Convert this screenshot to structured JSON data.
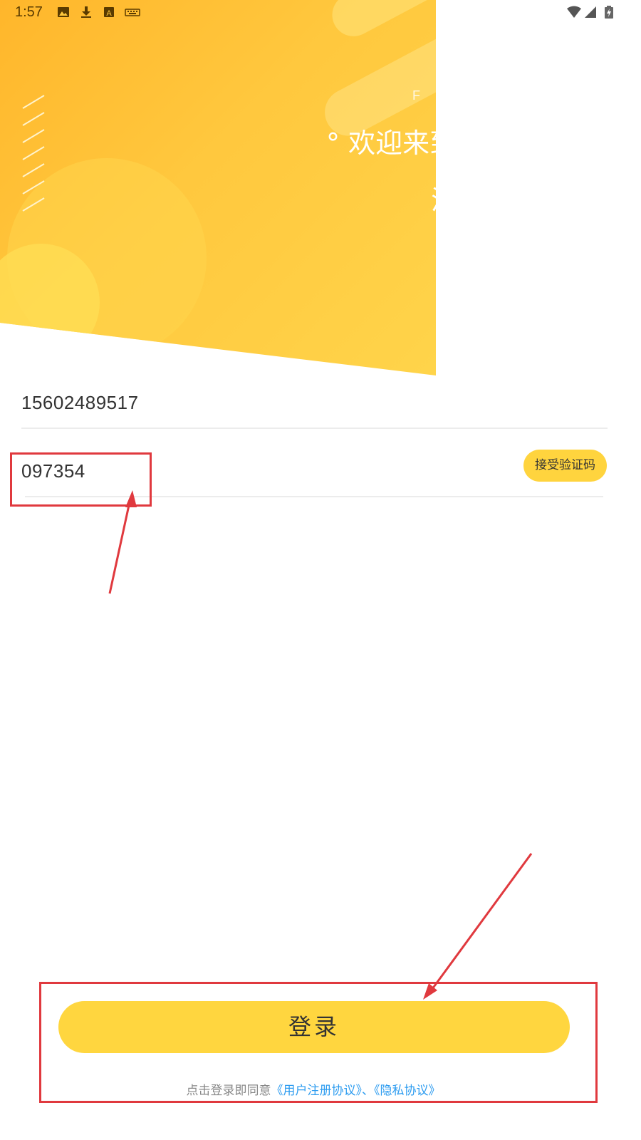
{
  "status_bar": {
    "time": "1:57",
    "left_icons": [
      "image-icon",
      "download-icon",
      "text-icon",
      "keyboard-icon"
    ],
    "right_icons": [
      "wifi-icon",
      "signal-icon",
      "battery-icon"
    ]
  },
  "hero": {
    "english_text": "F A",
    "welcome_text": "° 欢迎来到",
    "second_line": "汇"
  },
  "form": {
    "phone_value": "15602489517",
    "code_value": "097354",
    "code_button_label": "接受验证码"
  },
  "login": {
    "button_label": "登录",
    "agreement_prefix": "点击登录即同意",
    "user_agreement_link": "《用户注册协议》",
    "separator": "、",
    "privacy_link": "《隐私协议》"
  },
  "colors": {
    "accent": "#ffd63f",
    "link": "#2d9cf0",
    "annotation": "#e0393e"
  }
}
